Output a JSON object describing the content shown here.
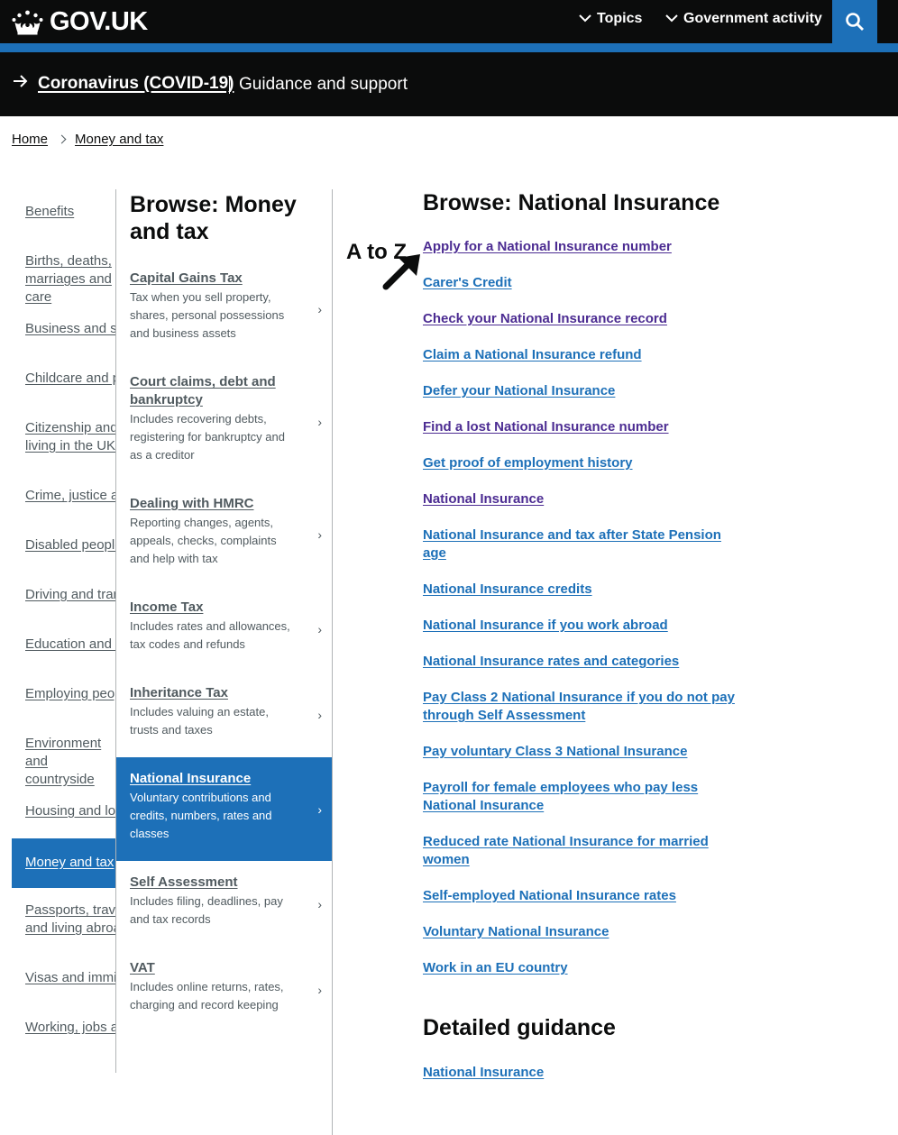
{
  "header": {
    "logo_text": "GOV.UK",
    "nav": [
      {
        "label": "Topics"
      },
      {
        "label": "Government activity"
      }
    ],
    "search_icon": "search-icon"
  },
  "covid_banner": {
    "link": "Coronavirus (COVID-19)",
    "subtitle": "Guidance and support"
  },
  "breadcrumb": [
    {
      "label": "Home"
    },
    {
      "label": "Money and tax"
    }
  ],
  "left_nav": [
    {
      "label": "Benefits"
    },
    {
      "label": "Births, deaths, marriages and care"
    },
    {
      "label": "Business and self-employed"
    },
    {
      "label": "Childcare and parenting"
    },
    {
      "label": "Citizenship and living in the UK"
    },
    {
      "label": "Crime, justice and the law"
    },
    {
      "label": "Disabled people"
    },
    {
      "label": "Driving and transport"
    },
    {
      "label": "Education and learning"
    },
    {
      "label": "Employing people"
    },
    {
      "label": "Environment and countryside"
    },
    {
      "label": "Housing and local services"
    },
    {
      "label": "Money and tax",
      "active": true
    },
    {
      "label": "Passports, travel and living abroad"
    },
    {
      "label": "Visas and immigration"
    },
    {
      "label": "Working, jobs and pensions"
    }
  ],
  "middle": {
    "title": "Browse: Money and tax",
    "items": [
      {
        "title": "Capital Gains Tax",
        "desc": "Tax when you sell property, shares, personal possessions and business assets"
      },
      {
        "title": "Court claims, debt and bankruptcy",
        "desc": "Includes recovering debts, registering for bankruptcy and as a creditor"
      },
      {
        "title": "Dealing with HMRC",
        "desc": "Reporting changes, agents, appeals, checks, complaints and help with tax"
      },
      {
        "title": "Income Tax",
        "desc": "Includes rates and allowances, tax codes and refunds"
      },
      {
        "title": "Inheritance Tax",
        "desc": "Includes valuing an estate, trusts and taxes"
      },
      {
        "title": "National Insurance",
        "desc": "Voluntary contributions and credits, numbers, rates and classes",
        "active": true
      },
      {
        "title": "Self Assessment",
        "desc": "Includes filing, deadlines, pay and tax records"
      },
      {
        "title": "VAT",
        "desc": "Includes online returns, rates, charging and record keeping"
      }
    ],
    "chevron": "›"
  },
  "right": {
    "title": "Browse: National Insurance",
    "links": [
      {
        "label": "Apply for a National Insurance number",
        "visited": true
      },
      {
        "label": "Carer's Credit",
        "visited": false
      },
      {
        "label": "Check your National Insurance record",
        "visited": true
      },
      {
        "label": "Claim a National Insurance refund",
        "visited": false
      },
      {
        "label": "Defer your National Insurance",
        "visited": false
      },
      {
        "label": "Find a lost National Insurance number",
        "visited": true
      },
      {
        "label": "Get proof of employment history",
        "visited": false
      },
      {
        "label": "National Insurance",
        "visited": true
      },
      {
        "label": "National Insurance and tax after State Pension age",
        "visited": false
      },
      {
        "label": "National Insurance credits",
        "visited": false
      },
      {
        "label": "National Insurance if you work abroad",
        "visited": false
      },
      {
        "label": "National Insurance rates and categories",
        "visited": false
      },
      {
        "label": "Pay Class 2 National Insurance if you do not pay through Self Assessment",
        "visited": false
      },
      {
        "label": "Pay voluntary Class 3 National Insurance",
        "visited": false
      },
      {
        "label": "Payroll for female employees who pay less National Insurance",
        "visited": false
      },
      {
        "label": "Reduced rate National Insurance for married women",
        "visited": false
      },
      {
        "label": "Self-employed National Insurance rates",
        "visited": false
      },
      {
        "label": "Voluntary National Insurance",
        "visited": false
      },
      {
        "label": "Work in an EU country",
        "visited": false
      }
    ],
    "detailed_title": "Detailed guidance",
    "detailed_link": "National Insurance"
  },
  "annotation": {
    "text": "A to Z"
  },
  "colors": {
    "link": "#1d70b8",
    "visited": "#4c2c92",
    "header": "#0b0c0c",
    "brand_blue": "#1d70b8",
    "secondary_text": "#505a5f"
  }
}
